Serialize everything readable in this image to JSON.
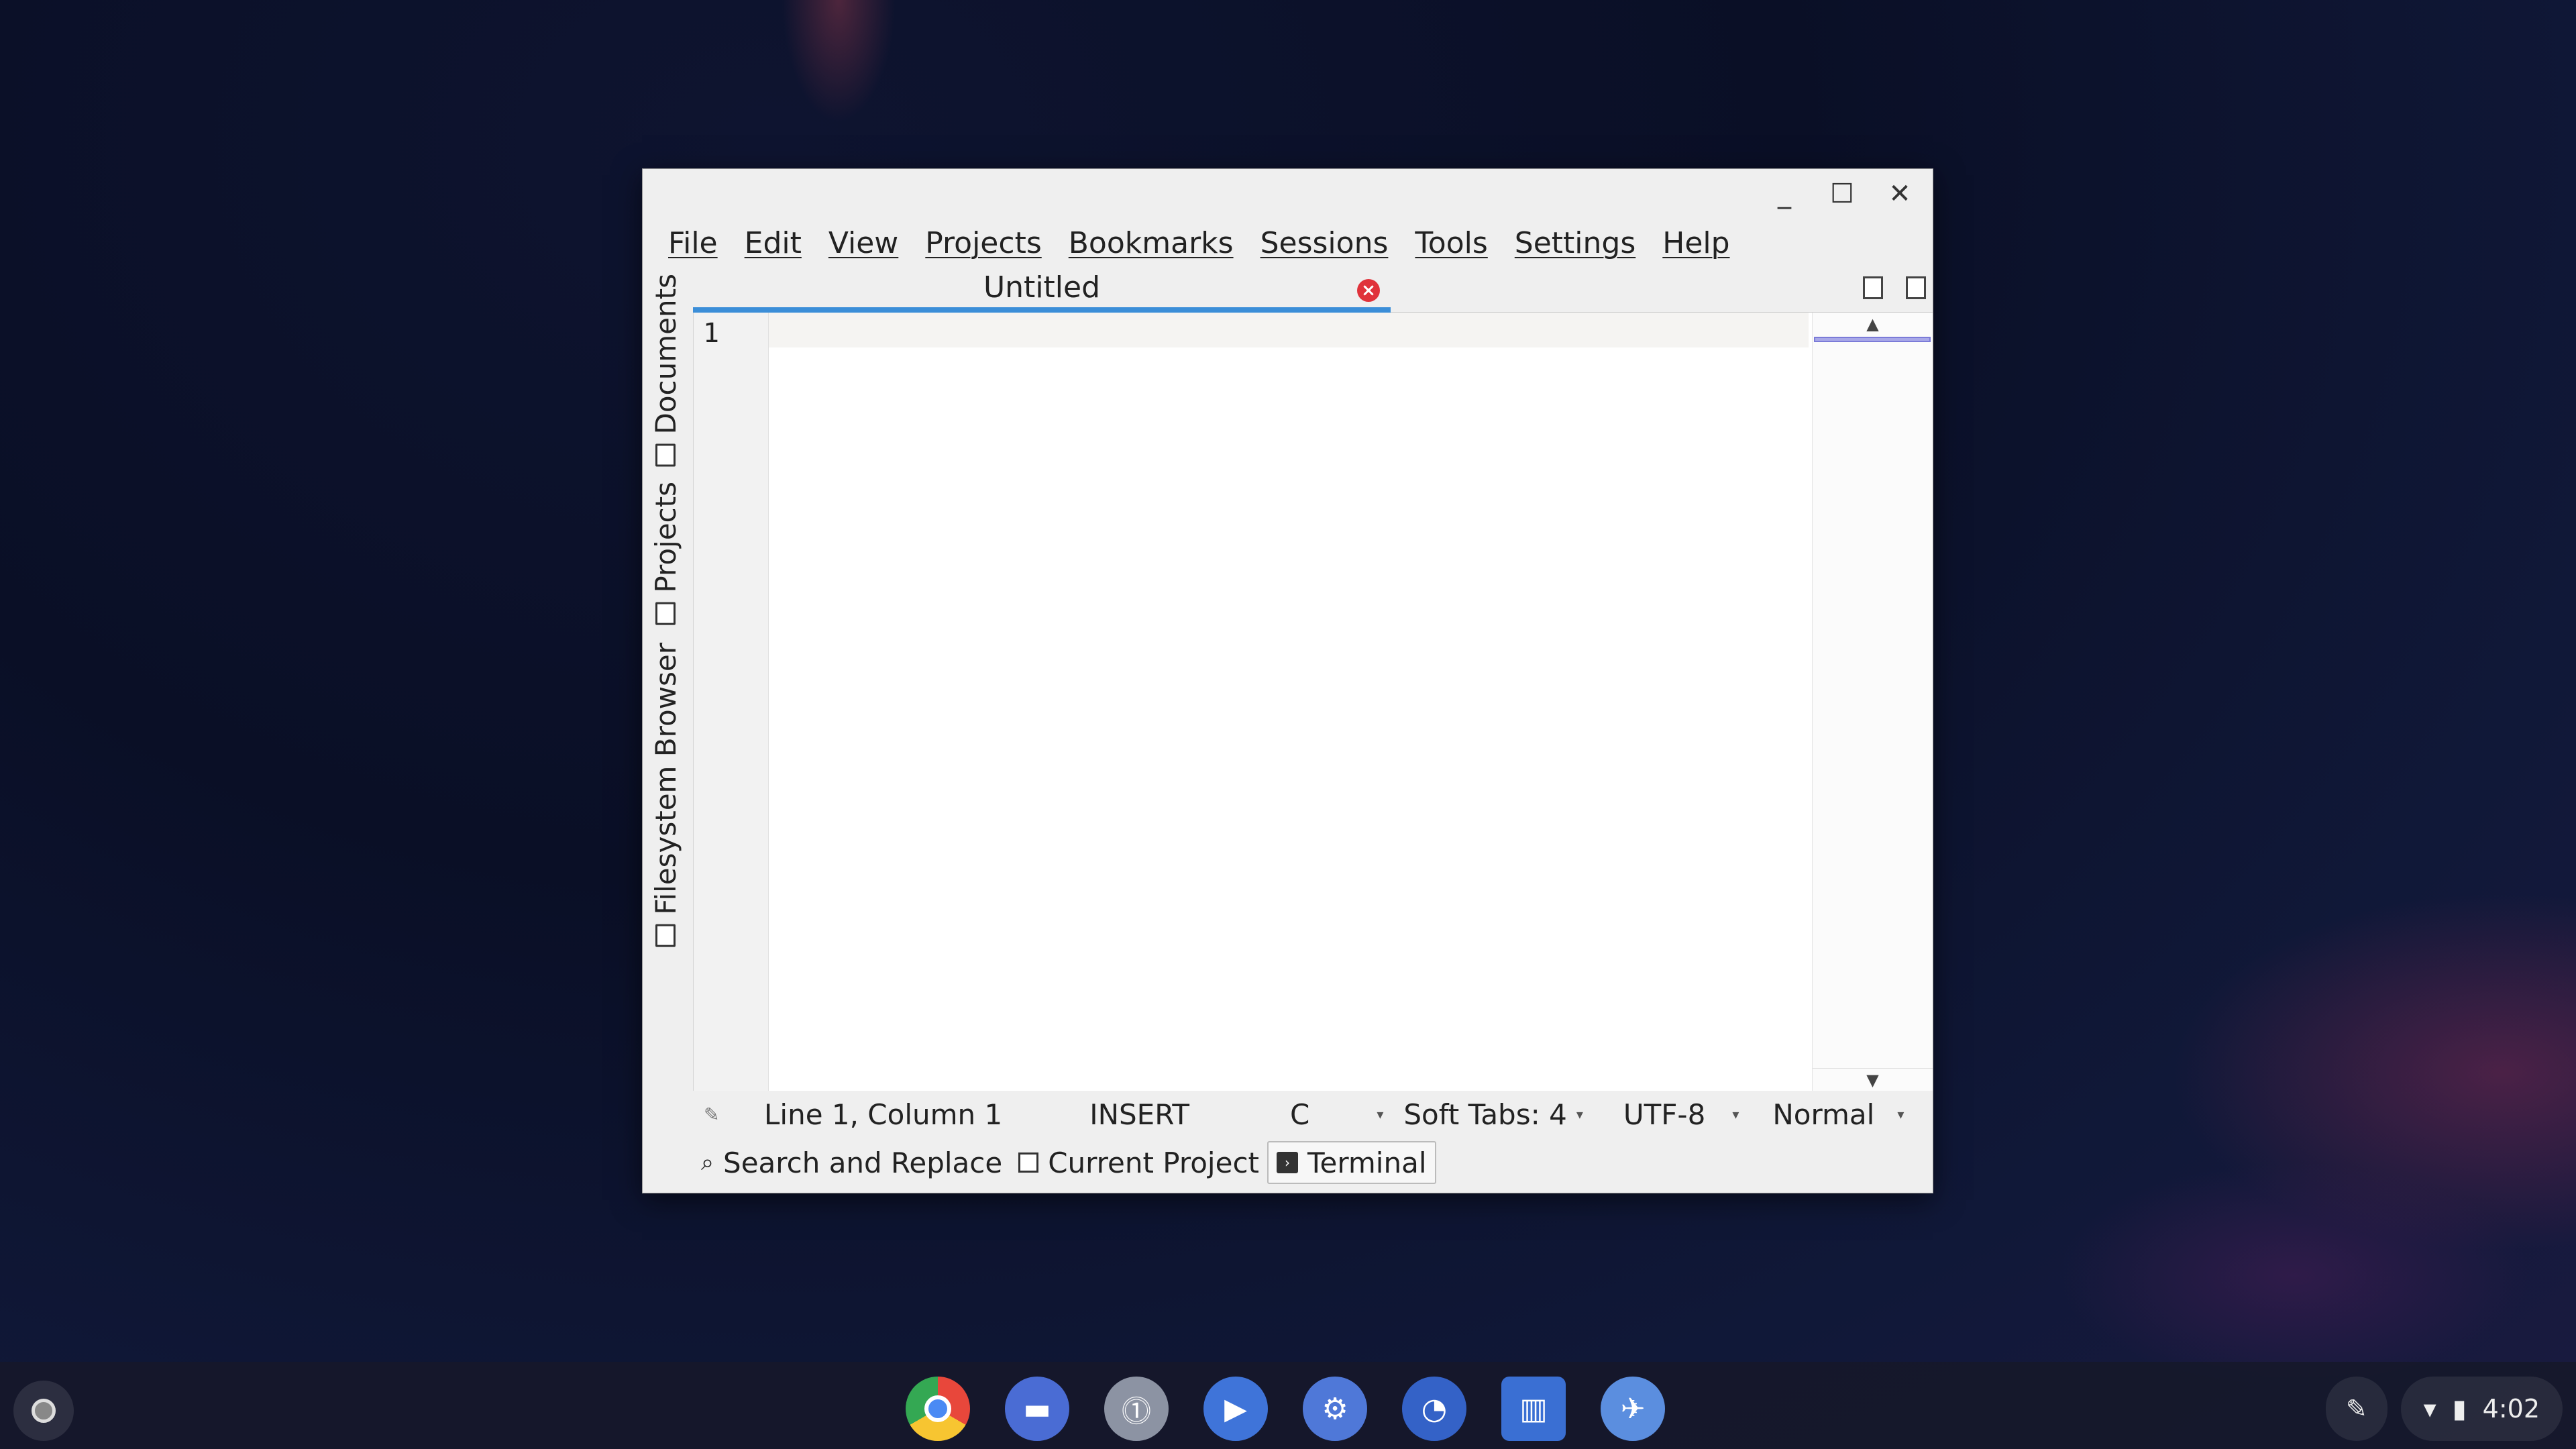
{
  "window": {
    "controls": {
      "minimize": "_",
      "maximize": "☐",
      "close": "✕"
    },
    "menu": [
      "File",
      "Edit",
      "View",
      "Projects",
      "Bookmarks",
      "Sessions",
      "Tools",
      "Settings",
      "Help"
    ]
  },
  "sidebar": {
    "tabs": [
      "Documents",
      "Projects",
      "Filesystem Browser"
    ]
  },
  "tab": {
    "title": "Untitled",
    "close": "×"
  },
  "editor": {
    "line_number": "1",
    "scroll_up": "▲",
    "scroll_down": "▼"
  },
  "status": {
    "position": "Line 1, Column 1",
    "mode": "INSERT",
    "language": "C",
    "indent": "Soft Tabs: 4",
    "encoding": "UTF-8",
    "input_mode": "Normal",
    "dd_arrow": "▾"
  },
  "bottom_tabs": {
    "search": "Search and Replace",
    "project": "Current Project",
    "terminal": "Terminal"
  },
  "shelf": {
    "apps": [
      {
        "name": "chrome-icon",
        "color": "#e8473b"
      },
      {
        "name": "files-icon",
        "color": "#4a6cd4"
      },
      {
        "name": "password-manager-icon",
        "color": "#8c93a3"
      },
      {
        "name": "video-call-icon",
        "color": "#3f74d9"
      },
      {
        "name": "settings-icon",
        "color": "#4f78d8"
      },
      {
        "name": "app-icon",
        "color": "#3462c7"
      },
      {
        "name": "trello-icon",
        "color": "#3a6fd3"
      },
      {
        "name": "editor-icon",
        "color": "#5b8edf"
      }
    ],
    "time": "4:02"
  }
}
